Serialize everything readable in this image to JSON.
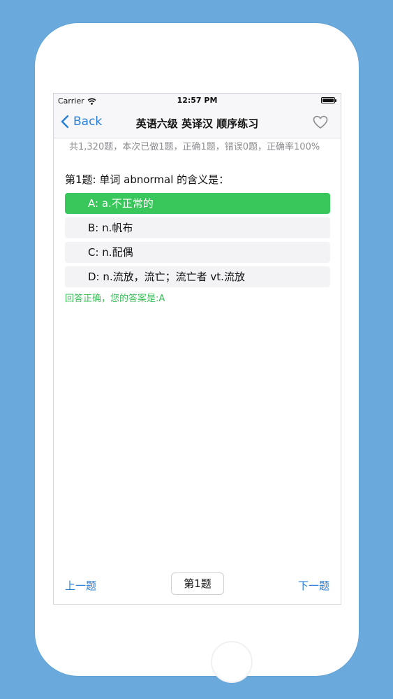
{
  "status_bar": {
    "carrier": "Carrier",
    "time": "12:57 PM"
  },
  "nav": {
    "back_label": "Back",
    "title": "英语六级 英译汉 顺序练习"
  },
  "stats_text": "共1,320题，本次已做1题，正确1题，错误0题，正确率100%",
  "question": "第1题: 单词 abnormal 的含义是：",
  "options": [
    {
      "label": "A: a.不正常的",
      "selected": true
    },
    {
      "label": "B: n.帆布",
      "selected": false
    },
    {
      "label": "C: n.配偶",
      "selected": false
    },
    {
      "label": "D: n.流放，流亡；流亡者 vt.流放",
      "selected": false
    }
  ],
  "result_text": "回答正确，您的答案是:A",
  "bottom": {
    "prev_label": "上一题",
    "page_label": "第1题",
    "next_label": "下一题"
  },
  "colors": {
    "accent": "#2a7fd6",
    "correct": "#39c75b",
    "background": "#69a9dc"
  },
  "icons": {
    "back": "chevron-left-icon",
    "favorite": "heart-outline-icon",
    "wifi": "wifi-icon",
    "battery": "battery-icon"
  }
}
